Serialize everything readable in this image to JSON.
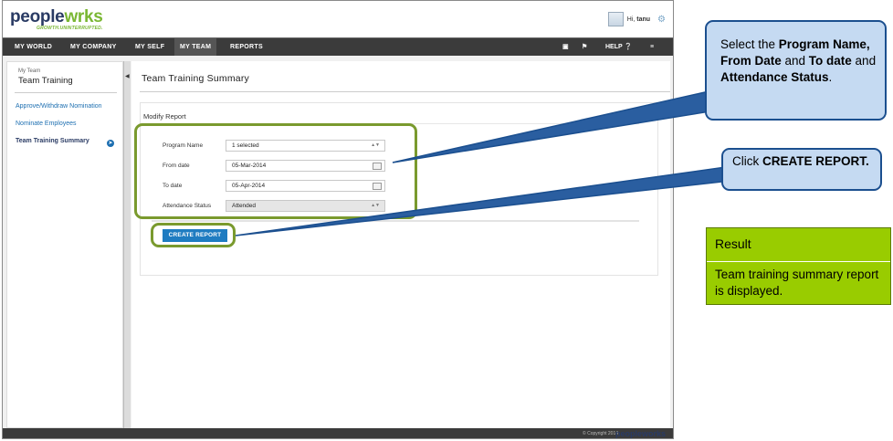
{
  "app": {
    "logo": {
      "part1": "pe",
      "part2": "ople",
      "part3": "w",
      "part4": "rks",
      "tagline": "GROWTH.UNINTERRUPTED."
    },
    "user": {
      "greeting_prefix": "Hi,",
      "name": "tanu"
    }
  },
  "nav": {
    "items": [
      {
        "label": "MY WORLD"
      },
      {
        "label": "MY COMPANY"
      },
      {
        "label": "MY SELF"
      },
      {
        "label": "MY TEAM"
      },
      {
        "label": "REPORTS"
      }
    ],
    "help_label": "HELP"
  },
  "sidebar": {
    "subtitle": "My Team",
    "title": "Team Training",
    "links": [
      {
        "label": "Approve/Withdraw Nomination"
      },
      {
        "label": "Nominate Employees"
      },
      {
        "label": "Team Training Summary"
      }
    ]
  },
  "main": {
    "title": "Team Training Summary",
    "section_label": "Modify Report",
    "fields": {
      "program_name": {
        "label": "Program Name",
        "value": "1 selected"
      },
      "from_date": {
        "label": "From date",
        "value": "05-Mar-2014"
      },
      "to_date": {
        "label": "To date",
        "value": "05-Apr-2014"
      },
      "attendance_status": {
        "label": "Attendance Status",
        "value": "Attended"
      }
    },
    "create_button": "CREATE REPORT"
  },
  "footer": {
    "copyright": "© Copyright 2014",
    "logo_text": "peopleworks"
  },
  "callouts": {
    "c1": {
      "t1": "Select the ",
      "b1": "Program Name, From Date",
      "t2": " and ",
      "b2": "To date",
      "t3": " and ",
      "b3": "Attendance Status",
      "t4": "."
    },
    "c2": {
      "t1": "Click ",
      "b1": "CREATE REPORT."
    }
  },
  "result": {
    "heading": "Result",
    "text": "Team training summary report is displayed."
  },
  "colors": {
    "accent": "#1f7cc1",
    "nav_bg": "#3b3b3b",
    "highlight": "#7a9a2e",
    "callout_bg": "#c5daf2",
    "result_bg": "#99cc00"
  }
}
